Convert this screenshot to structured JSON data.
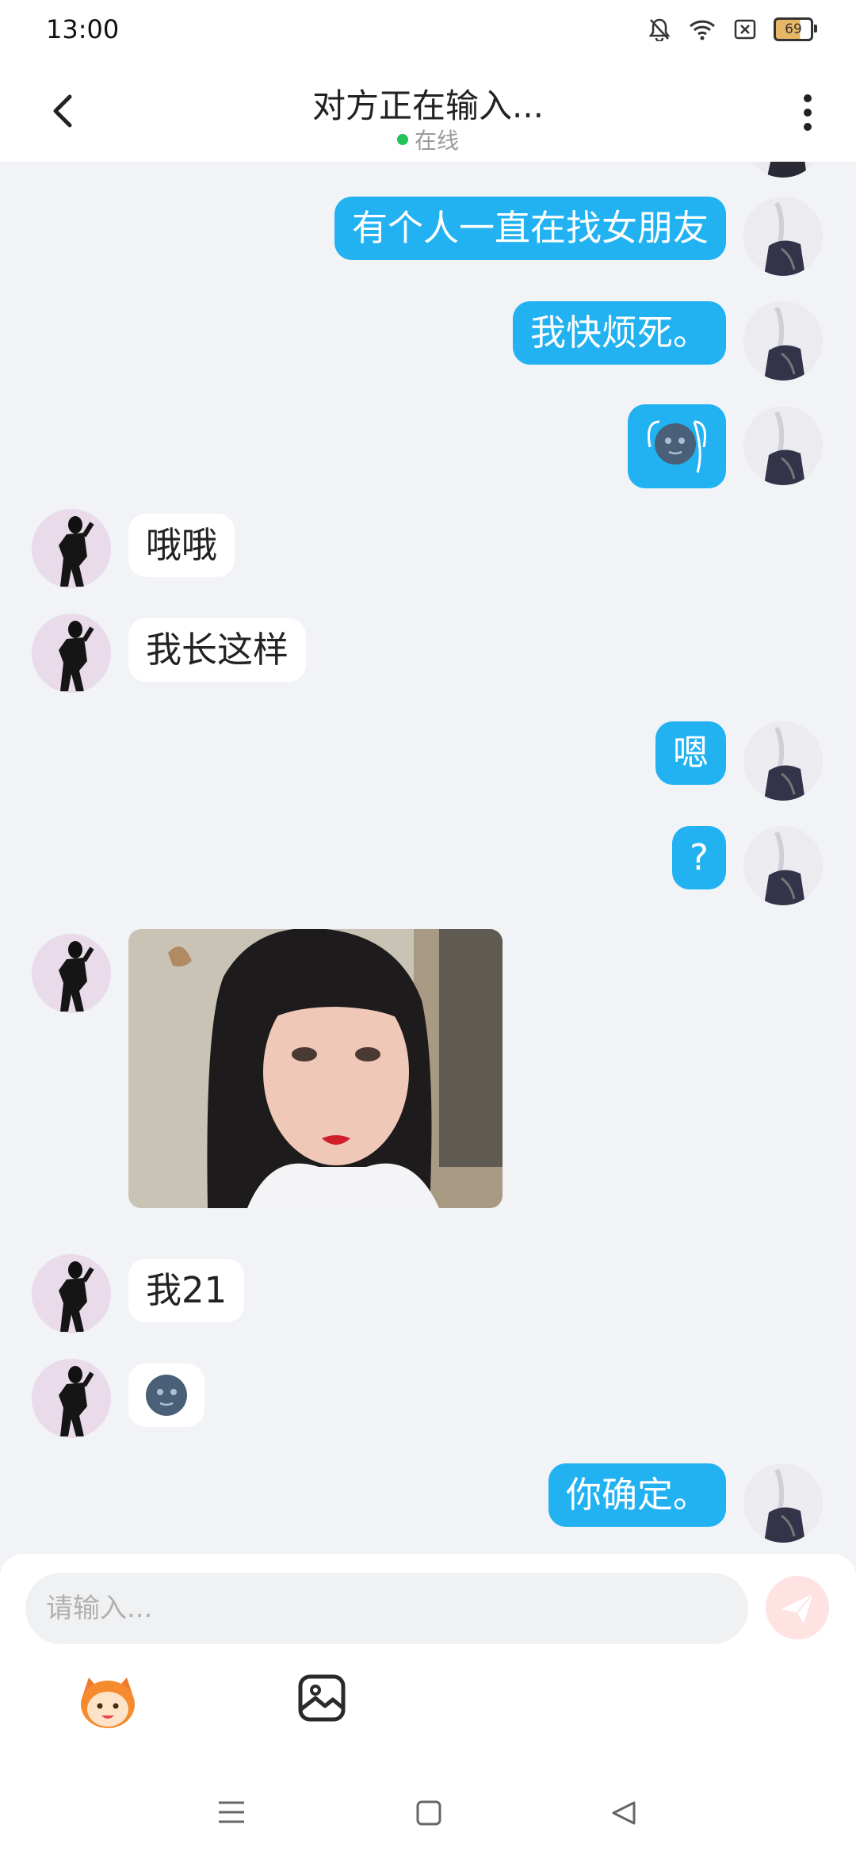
{
  "status_bar": {
    "time": "13:00",
    "battery": "69"
  },
  "header": {
    "title": "对方正在输入...",
    "status": "在线"
  },
  "messages": [
    {
      "from": "me",
      "type": "text",
      "text": "有个人一直在找女朋友"
    },
    {
      "from": "me",
      "type": "text",
      "text": "我快烦死。"
    },
    {
      "from": "me",
      "type": "emoji",
      "emoji": "🌚"
    },
    {
      "from": "her",
      "type": "text",
      "text": "哦哦"
    },
    {
      "from": "her",
      "type": "text",
      "text": "我长这样"
    },
    {
      "from": "me",
      "type": "text",
      "text": "嗯"
    },
    {
      "from": "me",
      "type": "text",
      "text": "?"
    },
    {
      "from": "her",
      "type": "image"
    },
    {
      "from": "her",
      "type": "text",
      "text": "我21"
    },
    {
      "from": "her",
      "type": "emoji",
      "emoji": "🌚"
    },
    {
      "from": "me",
      "type": "text",
      "text": "你确定。"
    }
  ],
  "input": {
    "placeholder": "请输入..."
  },
  "colors": {
    "my_bubble": "#22b2f2",
    "her_bubble": "#ffffff",
    "online_dot": "#22c35a",
    "send_button": "#ffe3e3"
  },
  "icons": [
    "back-arrow-icon",
    "more-vertical-icon",
    "send-icon",
    "emoji-sticker-icon",
    "image-icon",
    "menu-nav-icon",
    "home-nav-icon",
    "back-nav-icon"
  ]
}
